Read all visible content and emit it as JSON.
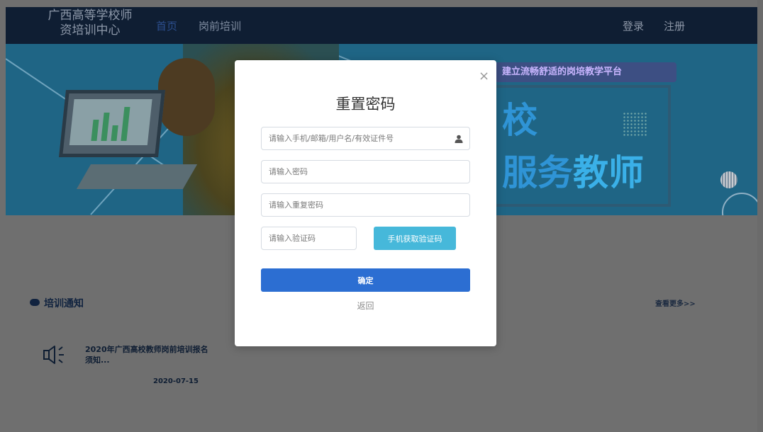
{
  "header": {
    "logo_line1": "广西高等学校师",
    "logo_line2": "资培训中心",
    "nav": [
      {
        "label": "首页",
        "active": true
      },
      {
        "label": "岗前培训",
        "active": false
      }
    ],
    "login_label": "登录",
    "register_label": "注册",
    "background_color": "#0f1e33"
  },
  "banner": {
    "slogan": "建立流畅舒适的岗培教学平台",
    "headline_line1": "校",
    "headline_line2_prefix": "服务",
    "headline_line2_accent": "教师"
  },
  "notices": {
    "section_title": "培训通知",
    "more_label": "查看更多>>",
    "items": [
      {
        "title": "2020年广西高校教师岗前培训报名须知...",
        "date": "2020-07-15"
      }
    ]
  },
  "modal": {
    "title": "重置密码",
    "close_label": "×",
    "account_placeholder": "请输入手机/邮箱/用户名/有效证件号",
    "password_placeholder": "请输入密码",
    "repeat_placeholder": "请输入重复密码",
    "code_placeholder": "请输入验证码",
    "sms_button_label": "手机获取验证码",
    "confirm_button_label": "确定",
    "back_label": "返回",
    "colors": {
      "confirm": "#2c6ed2",
      "sms": "#46b8da"
    }
  }
}
